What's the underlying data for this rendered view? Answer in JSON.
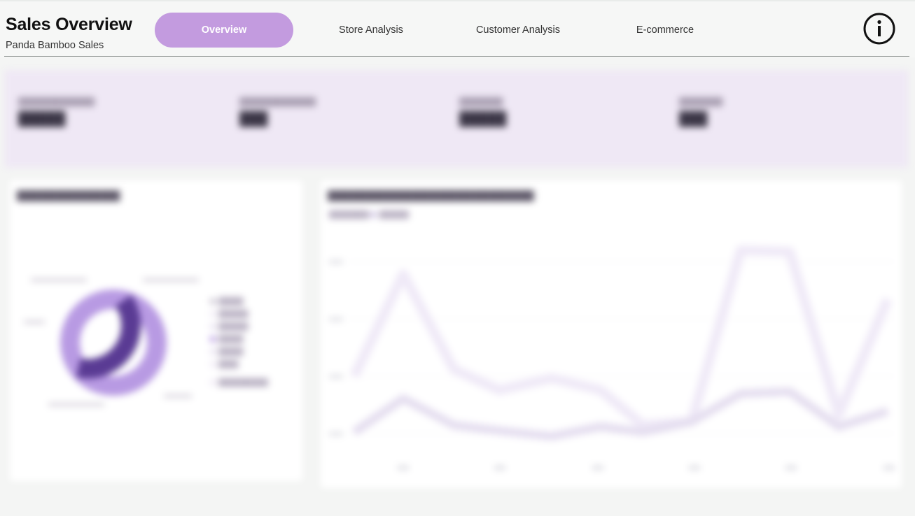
{
  "header": {
    "title": "Sales Overview",
    "subtitle": "Panda Bamboo Sales",
    "tabs": [
      {
        "label": "Overview",
        "active": true
      },
      {
        "label": "Store Analysis",
        "active": false
      },
      {
        "label": "Customer Analysis",
        "active": false
      },
      {
        "label": "E-commerce",
        "active": false
      }
    ],
    "info_icon": "info-circle-icon"
  },
  "colors": {
    "accent": "#c39bdf",
    "kpi_background": "#efe8f5",
    "dark_purple": "#5a3b94",
    "light_purple": "#b89ae3",
    "line_light": "#efe9f7",
    "line_dark": "#e4ddef"
  },
  "blurred_content": {
    "kpis": 4,
    "donut_segments": 2,
    "line_series": 2,
    "note": ""
  }
}
